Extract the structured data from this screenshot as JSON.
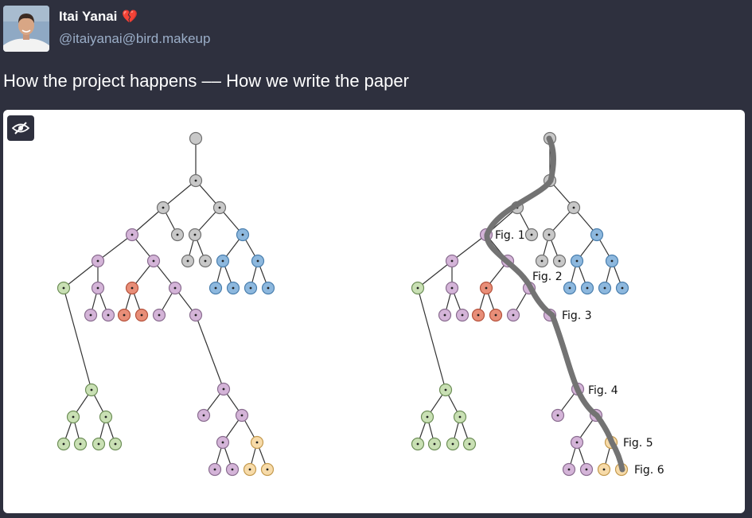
{
  "author": {
    "display_name": "Itai Yanai",
    "emoji": "💔",
    "handle": "@itaiyanai@bird.makeup"
  },
  "post": {
    "text": "How the project happens –– How we write the paper"
  },
  "figure": {
    "fig_labels": [
      "Fig. 1",
      "Fig. 2",
      "Fig. 3",
      "Fig. 4",
      "Fig. 5",
      "Fig. 6"
    ]
  },
  "colors": {
    "background": "#2e303e",
    "handle": "#9baec8",
    "node_gray": "#c8c8c8",
    "node_purple": "#d4b4d8",
    "node_blue": "#8db8de",
    "node_green": "#c9e0b4",
    "node_red": "#e88e78",
    "node_orange": "#f7dba9",
    "path": "#737373"
  },
  "icons": {
    "hide_media": "eye-slash-icon"
  }
}
